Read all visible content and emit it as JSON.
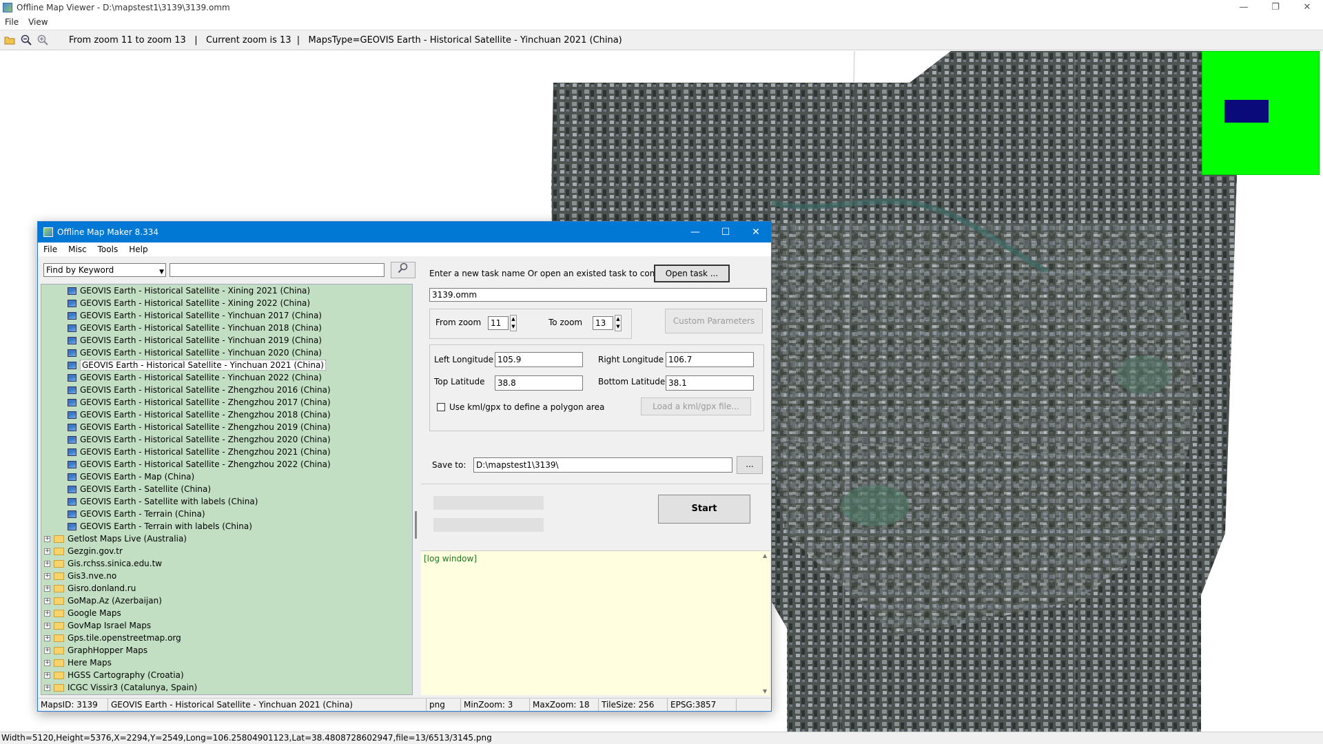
{
  "viewer": {
    "title": "Offline Map Viewer - D:\\mapstest1\\3139\\3139.omm",
    "window_buttons": [
      "—",
      "❐",
      "✕"
    ],
    "menu": [
      "File",
      "View"
    ],
    "toolbar_status": "From zoom 11 to zoom 13   |   Current zoom is 13  |   MapsType=GEOVIS Earth - Historical Satellite - Yinchuan 2021 (China)",
    "statusbar": "Width=5120,Height=5376,X=2294,Y=2549,Long=106.25804901123,Lat=38.4808728602947,file=13/6513/3145.png"
  },
  "colors": {
    "dialog_title_bg": "#0078d4",
    "tree_bg": "#c3dfc3",
    "log_bg": "#ffffe0",
    "minimap_bg": "#00ff00",
    "minimap_view": "#0a0a7a"
  },
  "dialog": {
    "title": "Offline Map Maker 8.334",
    "menu": [
      "File",
      "Misc",
      "Tools",
      "Help"
    ],
    "find_mode": "Find by Keyword",
    "search_value": "",
    "tree_items": [
      {
        "type": "leaf",
        "label": "GEOVIS Earth - Historical Satellite - Xining 2021 (China)"
      },
      {
        "type": "leaf",
        "label": "GEOVIS Earth - Historical Satellite - Xining 2022 (China)"
      },
      {
        "type": "leaf",
        "label": "GEOVIS Earth - Historical Satellite - Yinchuan 2017 (China)"
      },
      {
        "type": "leaf",
        "label": "GEOVIS Earth - Historical Satellite - Yinchuan 2018 (China)"
      },
      {
        "type": "leaf",
        "label": "GEOVIS Earth - Historical Satellite - Yinchuan 2019 (China)"
      },
      {
        "type": "leaf",
        "label": "GEOVIS Earth - Historical Satellite - Yinchuan 2020 (China)"
      },
      {
        "type": "leaf",
        "label": "GEOVIS Earth - Historical Satellite - Yinchuan 2021 (China)",
        "selected": true
      },
      {
        "type": "leaf",
        "label": "GEOVIS Earth - Historical Satellite - Yinchuan 2022 (China)"
      },
      {
        "type": "leaf",
        "label": "GEOVIS Earth - Historical Satellite - Zhengzhou 2016 (China)"
      },
      {
        "type": "leaf",
        "label": "GEOVIS Earth - Historical Satellite - Zhengzhou 2017 (China)"
      },
      {
        "type": "leaf",
        "label": "GEOVIS Earth - Historical Satellite - Zhengzhou 2018 (China)"
      },
      {
        "type": "leaf",
        "label": "GEOVIS Earth - Historical Satellite - Zhengzhou 2019 (China)"
      },
      {
        "type": "leaf",
        "label": "GEOVIS Earth - Historical Satellite - Zhengzhou 2020 (China)"
      },
      {
        "type": "leaf",
        "label": "GEOVIS Earth - Historical Satellite - Zhengzhou 2021 (China)"
      },
      {
        "type": "leaf",
        "label": "GEOVIS Earth - Historical Satellite - Zhengzhou 2022 (China)"
      },
      {
        "type": "leaf",
        "label": "GEOVIS Earth - Map (China)"
      },
      {
        "type": "leaf",
        "label": "GEOVIS Earth - Satellite (China)"
      },
      {
        "type": "leaf",
        "label": "GEOVIS Earth - Satellite with labels (China)"
      },
      {
        "type": "leaf",
        "label": "GEOVIS Earth - Terrain (China)"
      },
      {
        "type": "leaf",
        "label": "GEOVIS Earth - Terrain with labels (China)"
      },
      {
        "type": "folder",
        "label": "Getlost Maps Live (Australia)"
      },
      {
        "type": "folder",
        "label": "Gezgin.gov.tr"
      },
      {
        "type": "folder",
        "label": "Gis.rchss.sinica.edu.tw"
      },
      {
        "type": "folder",
        "label": "Gis3.nve.no"
      },
      {
        "type": "folder",
        "label": "Gisro.donland.ru"
      },
      {
        "type": "folder",
        "label": "GoMap.Az (Azerbaijan)"
      },
      {
        "type": "folder",
        "label": "Google Maps"
      },
      {
        "type": "folder",
        "label": "GovMap Israel Maps"
      },
      {
        "type": "folder",
        "label": "Gps.tile.openstreetmap.org"
      },
      {
        "type": "folder",
        "label": "GraphHopper Maps"
      },
      {
        "type": "folder",
        "label": "Here Maps"
      },
      {
        "type": "folder",
        "label": "HGSS Cartography (Croatia)"
      },
      {
        "type": "folder",
        "label": "ICGC Vissir3 (Catalunya, Spain)"
      }
    ],
    "task_prompt": "Enter a new task name Or open an existed task to continue:",
    "open_task_label": "Open task ...",
    "task_name": "3139.omm",
    "from_zoom_label": "From zoom",
    "from_zoom": "11",
    "to_zoom_label": "To zoom",
    "to_zoom": "13",
    "custom_params_label": "Custom Parameters",
    "left_lon_label": "Left Longitude",
    "left_lon": "105.9",
    "right_lon_label": "Right Longitude",
    "right_lon": "106.7",
    "top_lat_label": "Top Latitude",
    "top_lat": "38.8",
    "bottom_lat_label": "Bottom Latitude",
    "bottom_lat": "38.1",
    "kml_checkbox_label": "Use kml/gpx to define a polygon area",
    "load_kml_label": "Load a kml/gpx file...",
    "save_to_label": "Save to:",
    "save_to": "D:\\mapstest1\\3139\\",
    "browse_label": "...",
    "start_label": "Start",
    "log_text": "[log window]",
    "status": {
      "maps_id": "MapsID: 3139",
      "maps_name": "GEOVIS Earth - Historical Satellite - Yinchuan 2021 (China)",
      "format": "png",
      "min_zoom": "MinZoom: 3",
      "max_zoom": "MaxZoom: 18",
      "tile_size": "TileSize: 256",
      "epsg": "EPSG:3857"
    }
  }
}
